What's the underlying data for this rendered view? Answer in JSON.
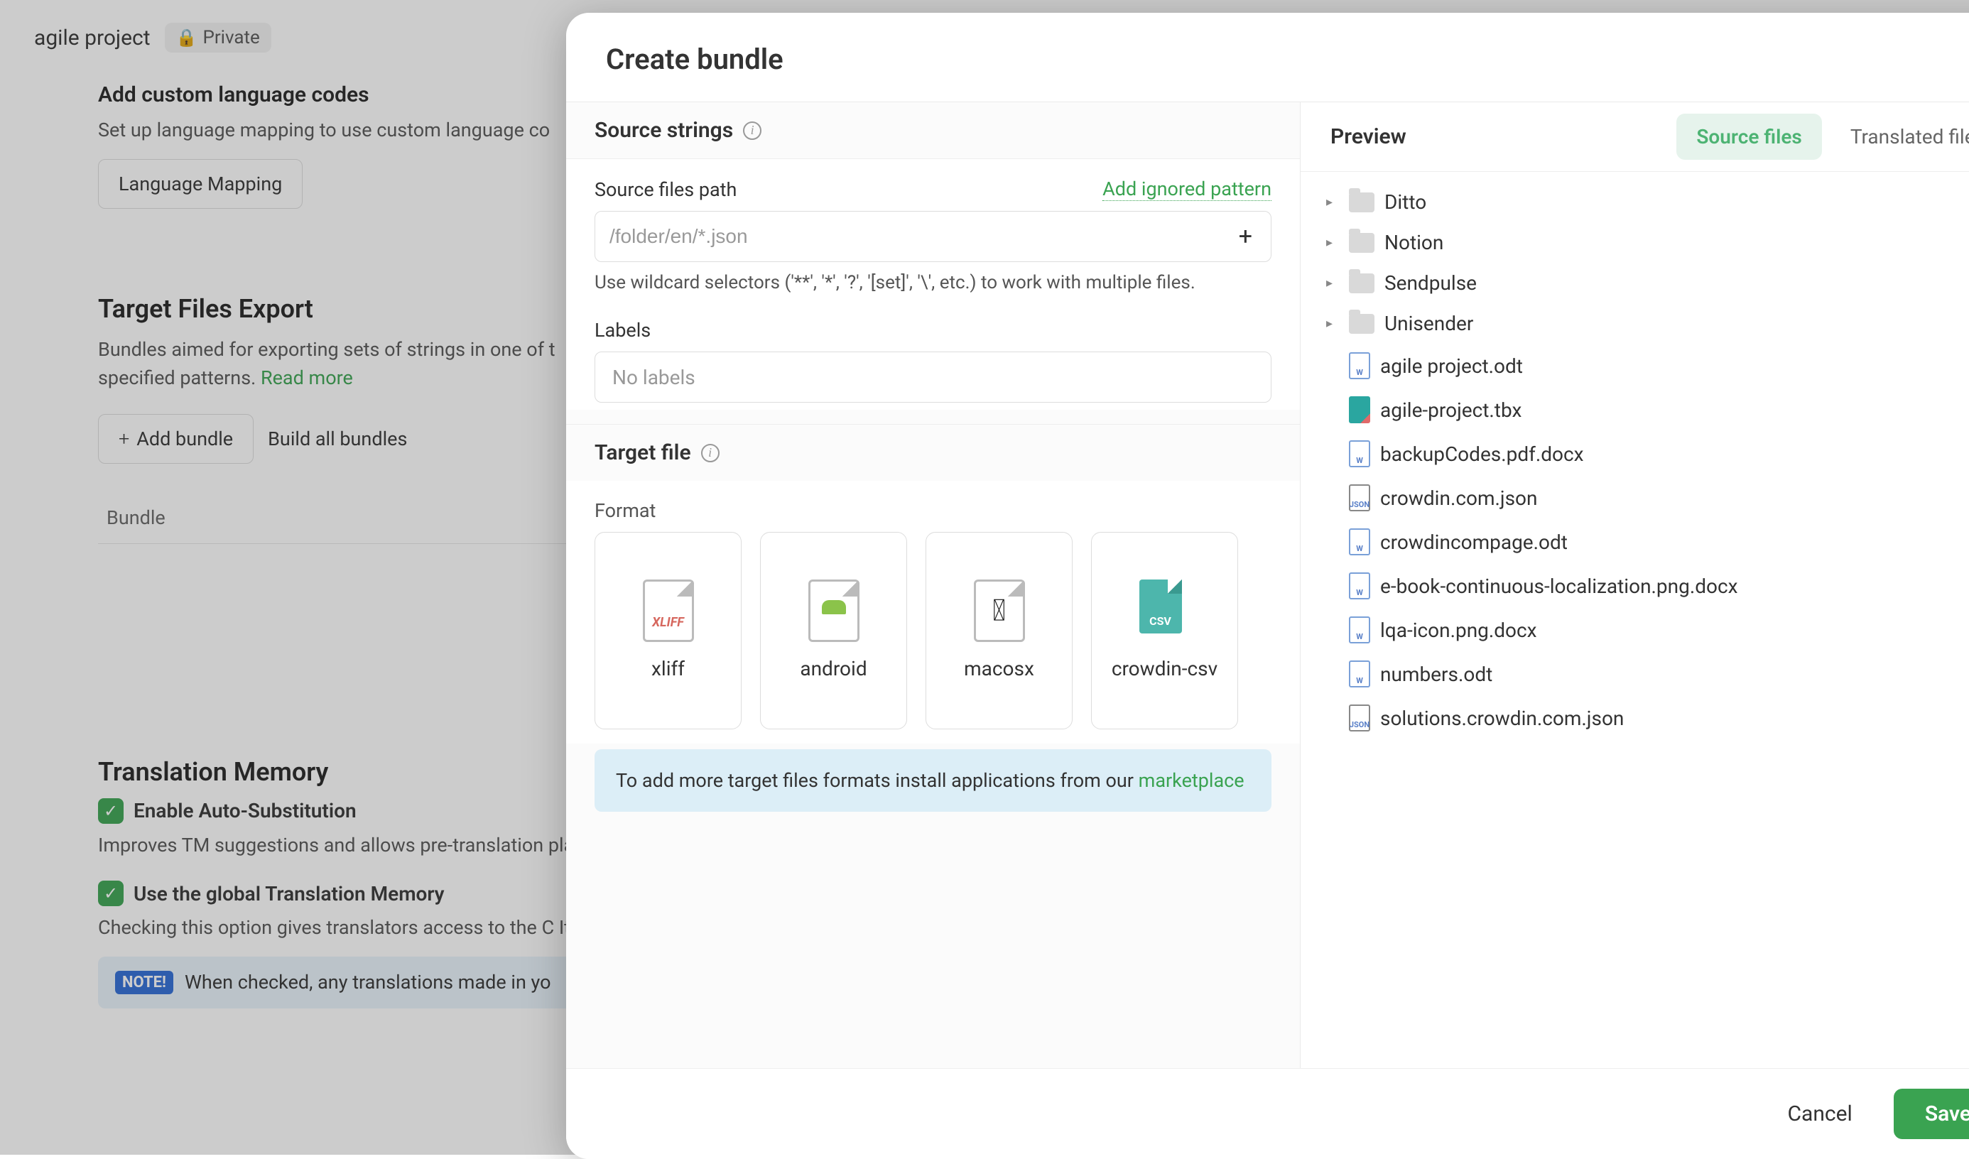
{
  "bg": {
    "project_title": "agile project",
    "private_label": "Private",
    "sec1_h": "Add custom language codes",
    "sec1_p": "Set up language mapping to use custom language co",
    "sec1_btn": "Language Mapping",
    "sec2_h": "Target Files Export",
    "sec2_p_a": "Bundles aimed for exporting sets of strings in one of t",
    "sec2_p_b": "specified patterns. ",
    "sec2_link": "Read more",
    "sec2_btn_add": "Add bundle",
    "sec2_btn_build": "Build all bundles",
    "sec2_col": "Bundle",
    "sec3_h": "Translation Memory",
    "sec3_c1": "Enable Auto-Substitution",
    "sec3_c1_p": "Improves TM suggestions and allows pre-translation placeholders, numbers and more) in translations sug",
    "sec3_c2": "Use the global Translation Memory",
    "sec3_c2_p": "Checking this option gives translators access to the C It's a huge vault of existing translations contributed b",
    "note_pill": "NOTE!",
    "note_text": "When checked, any translations made in yo"
  },
  "modal": {
    "title": "Create bundle",
    "source_section": "Source strings",
    "path_label": "Source files path",
    "path_link": "Add ignored pattern",
    "path_placeholder": "/folder/en/*.json",
    "hint": "Use wildcard selectors ('**', '*', '?', '[set]', '\\', etc.) to work with multiple files.",
    "labels_label": "Labels",
    "labels_placeholder": "No labels",
    "target_section": "Target file",
    "format_label": "Format",
    "formats": [
      {
        "key": "xliff",
        "name": "xliff"
      },
      {
        "key": "android",
        "name": "android"
      },
      {
        "key": "macosx",
        "name": "macosx"
      },
      {
        "key": "crowdin-csv",
        "name": "crowdin-csv"
      }
    ],
    "banner_a": "To add more target files formats install applications from our ",
    "banner_link": "marketplace",
    "preview_title": "Preview",
    "tab_source": "Source files",
    "tab_translated": "Translated files",
    "tree": {
      "folders": [
        "Ditto",
        "Notion",
        "Sendpulse",
        "Unisender"
      ],
      "files": [
        {
          "name": "agile project.odt",
          "kind": "word"
        },
        {
          "name": "agile-project.tbx",
          "kind": "tbx"
        },
        {
          "name": "backupCodes.pdf.docx",
          "kind": "word"
        },
        {
          "name": "crowdin.com.json",
          "kind": "json"
        },
        {
          "name": "crowdincompage.odt",
          "kind": "word"
        },
        {
          "name": "e-book-continuous-localization.png.docx",
          "kind": "word"
        },
        {
          "name": "lqa-icon.png.docx",
          "kind": "word"
        },
        {
          "name": "numbers.odt",
          "kind": "word"
        },
        {
          "name": "solutions.crowdin.com.json",
          "kind": "json"
        }
      ]
    },
    "cancel": "Cancel",
    "save": "Save"
  }
}
